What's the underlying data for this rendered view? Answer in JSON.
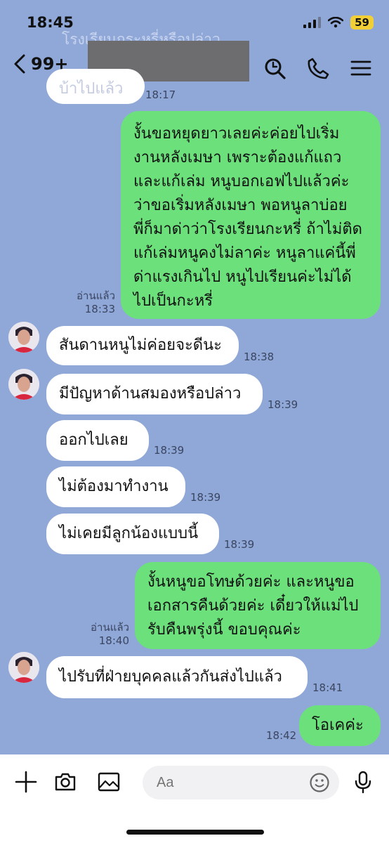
{
  "status": {
    "time": "18:45",
    "battery": "59"
  },
  "header": {
    "back_count": "99+"
  },
  "ghost": {
    "line1": "โรงเรียนกระหรี่หรือปล่าว",
    "line2": "บ้าไปแล้ว",
    "time": "18:17"
  },
  "messages": [
    {
      "side": "out",
      "lines": [
        "งั้นขอหยุดยาวเลยค่ะค่อยไปเริ่ม",
        "งานหลังเมษา เพราะต้องแก้แถว",
        "และแก้เล่ม หนูบอกเอฟไปแล้วค่ะ",
        "ว่าขอเริ่มหลังเมษา พอหนูลาบ่อย",
        "พี่ก็มาด่าว่าโรงเรียนกะหรี่ ถ้าไม่ติด",
        "แก้เล่มหนูคงไม่ลาค่ะ หนูลาแค่นี้พี่",
        "ด่าแรงเกินไป หนูไปเรียนค่ะไม่ได้",
        "ไปเป็นกะหรี่"
      ],
      "read": "อ่านแล้ว",
      "time": "18:33"
    },
    {
      "side": "in",
      "text": "สันดานหนูไม่ค่อยจะดีนะ",
      "time": "18:38"
    },
    {
      "side": "in",
      "text": "มีปัญหาด้านสมองหรือปล่าว",
      "time": "18:39"
    },
    {
      "side": "in",
      "text": "ออกไปเลย",
      "time": "18:39"
    },
    {
      "side": "in",
      "text": "ไม่ต้องมาทำงาน",
      "time": "18:39"
    },
    {
      "side": "in",
      "text": "ไม่เคยมีลูกน้องแบบนี้",
      "time": "18:39"
    },
    {
      "side": "out",
      "lines": [
        "งั้นหนูขอโทษด้วยค่ะ และหนูขอ",
        "เอกสารคืนด้วยค่ะ เดี๋ยวให้แม่ไป",
        "รับคืนพรุ่งนี้ ขอบคุณค่ะ"
      ],
      "read": "อ่านแล้ว",
      "time": "18:40"
    },
    {
      "side": "in",
      "text": "ไปรับที่ฝ่ายบุคคลแล้วกันส่งไปแล้ว",
      "time": "18:41"
    },
    {
      "side": "out",
      "text": "โอเคค่ะ",
      "time": "18:42"
    }
  ],
  "input": {
    "placeholder": "Aa"
  },
  "icons": {
    "back": "chevron-left-icon",
    "search": "search-icon",
    "call": "phone-icon",
    "menu": "menu-icon",
    "add": "plus-icon",
    "camera": "camera-icon",
    "image": "image-icon",
    "emoji": "smiley-icon",
    "mic": "microphone-icon"
  },
  "colors": {
    "background": "#8fa8d8",
    "outgoing": "#6be07b",
    "incoming": "#ffffff",
    "battery": "#f2cf36"
  }
}
